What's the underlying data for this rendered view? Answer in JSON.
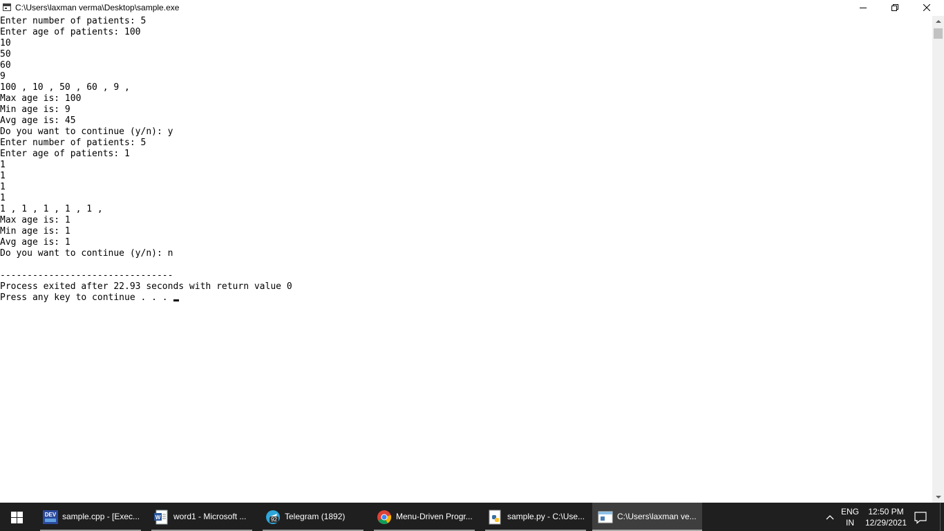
{
  "window": {
    "title": "C:\\Users\\laxman verma\\Desktop\\sample.exe"
  },
  "console": {
    "lines": [
      "Enter number of patients: 5",
      "Enter age of patients: 100",
      "10",
      "50",
      "60",
      "9",
      "100 , 10 , 50 , 60 , 9 ,",
      "Max age is: 100",
      "Min age is: 9",
      "Avg age is: 45",
      "Do you want to continue (y/n): y",
      "Enter number of patients: 5",
      "Enter age of patients: 1",
      "1",
      "1",
      "1",
      "1",
      "1 , 1 , 1 , 1 , 1 ,",
      "Max age is: 1",
      "Min age is: 1",
      "Avg age is: 1",
      "Do you want to continue (y/n): n",
      "",
      "--------------------------------",
      "Process exited after 22.93 seconds with return value 0",
      "Press any key to continue . . . "
    ]
  },
  "taskbar": {
    "items": [
      {
        "label": "sample.cpp - [Exec...",
        "icon": "devcpp-icon",
        "active": false
      },
      {
        "label": "word1 - Microsoft ...",
        "icon": "word-icon",
        "active": false
      },
      {
        "label": "Telegram (1892)",
        "icon": "telegram-icon",
        "badge": "92",
        "active": false
      },
      {
        "label": "Menu-Driven Progr...",
        "icon": "chrome-icon",
        "active": false
      },
      {
        "label": "sample.py - C:\\Use...",
        "icon": "python-icon",
        "active": false
      },
      {
        "label": "C:\\Users\\laxman ve...",
        "icon": "console-icon",
        "active": true
      }
    ],
    "language": {
      "line1": "ENG",
      "line2": "IN"
    },
    "clock": {
      "time": "12:50 PM",
      "date": "12/29/2021"
    }
  },
  "colors": {
    "taskbar_bg": "#1f1f1f",
    "taskbar_active": "#3e3e3e",
    "console_bg": "#ffffff",
    "console_text": "#000000"
  }
}
